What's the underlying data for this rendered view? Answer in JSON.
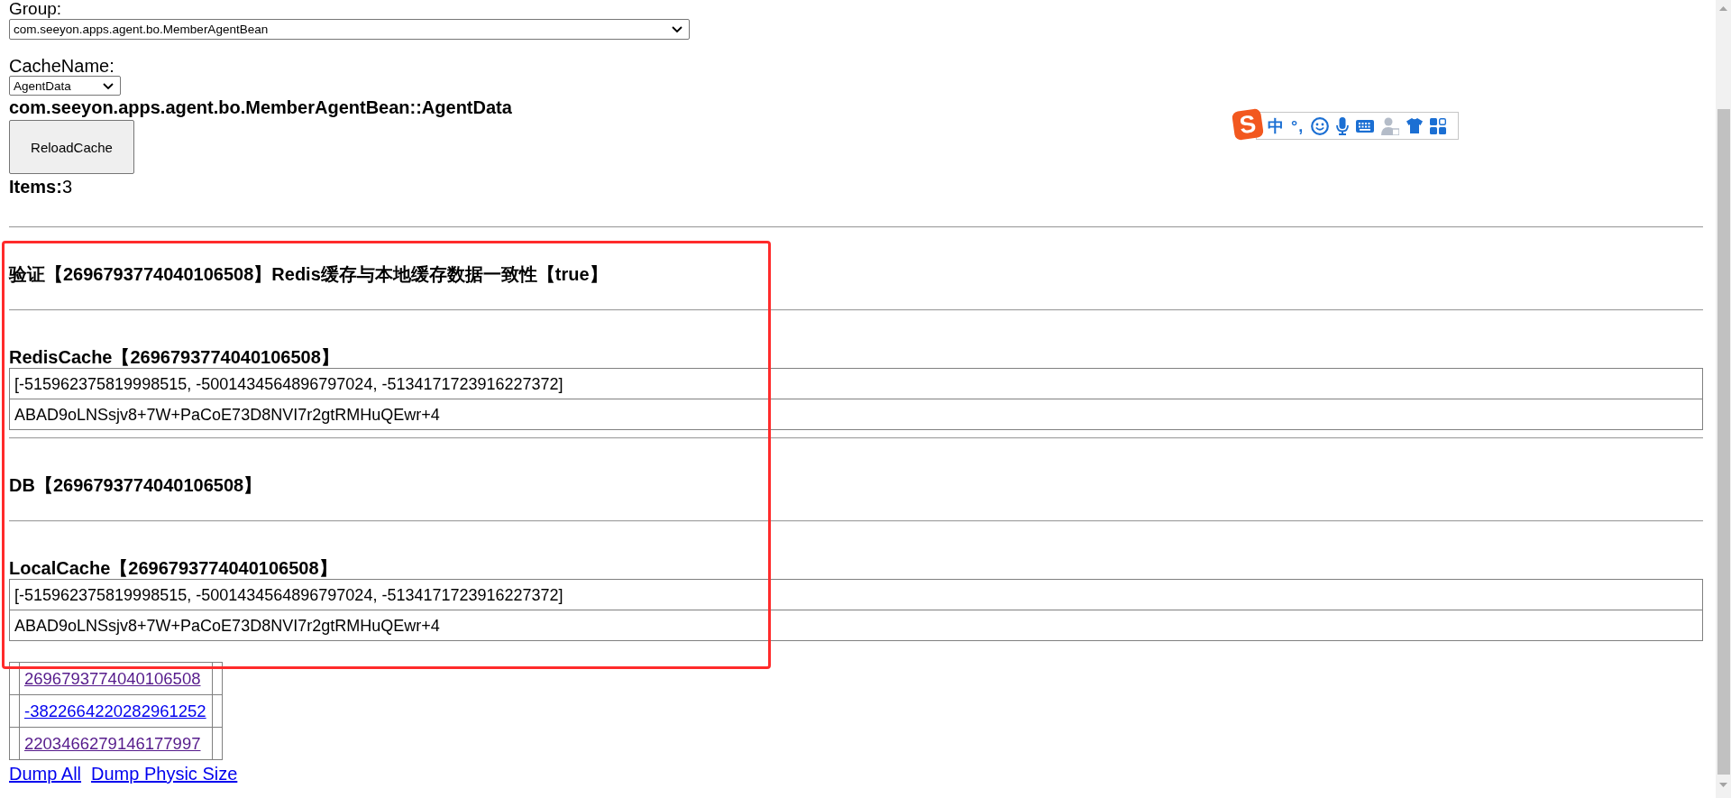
{
  "group": {
    "label": "Group:",
    "value": "com.seeyon.apps.agent.bo.MemberAgentBean"
  },
  "cache_name": {
    "label": "CacheName:",
    "value": "AgentData"
  },
  "cache_title": "com.seeyon.apps.agent.bo.MemberAgentBean::AgentData",
  "reload_button": "ReloadCache",
  "items_count": "**Items:**3",
  "sections": [
    {
      "kind": "check",
      "title": "验证【2696793774040106508】Redis缓存与本地缓存数据一致性【true】"
    },
    {
      "kind": "cache",
      "title": "RedisCache【2696793774040106508】",
      "rows": [
        "[-515962375819998515, -5001434564896797024, -5134171723916227372]",
        "ABAD9oLNSsjv8+7W+PaCoE73D8NVI7r2gtRMHuQEwr+4"
      ]
    },
    {
      "kind": "check",
      "title": "DB【2696793774040106508】"
    },
    {
      "kind": "cache",
      "title": "LocalCache【2696793774040106508】",
      "rows": [
        "[-515962375819998515, -5001434564896797024, -5134171723916227372]",
        "ABAD9oLNSsjv8+7W+PaCoE73D8NVI7r2gtRMHuQEwr+4"
      ]
    }
  ],
  "keys_table": {
    "rows": [
      {
        "link": "2696793774040106508",
        "visited": true
      },
      {
        "link": "-3822664220282961252",
        "visited": false
      },
      {
        "link": "2203466279146177997",
        "visited": true
      }
    ]
  },
  "footer_links": [
    "Dump All",
    "Dump Physic Size"
  ],
  "ime_toolbar": {
    "logo": "S",
    "items": [
      {
        "kind": "mode",
        "text": "中",
        "disabled": false
      },
      {
        "kind": "punctuation",
        "text": "°,",
        "disabled": false
      },
      {
        "kind": "emoji",
        "disabled": false
      },
      {
        "kind": "voice",
        "disabled": false
      },
      {
        "kind": "keyboard",
        "disabled": false
      },
      {
        "kind": "user",
        "disabled": true
      },
      {
        "kind": "skin",
        "disabled": false
      },
      {
        "kind": "toolbox",
        "disabled": false
      }
    ]
  }
}
